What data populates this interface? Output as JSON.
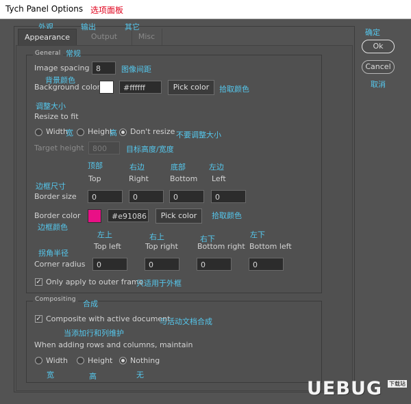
{
  "window": {
    "title": "Tych Panel Options",
    "title_cn": "选项面板"
  },
  "tabs": [
    {
      "label": "Appearance",
      "cn": "外观",
      "active": true
    },
    {
      "label": "Output",
      "cn": "输出",
      "active": false
    },
    {
      "label": "Misc",
      "cn": "其它",
      "active": false
    }
  ],
  "actions": {
    "ok": "Ok",
    "ok_cn": "确定",
    "cancel": "Cancel",
    "cancel_cn": "取消"
  },
  "general": {
    "legend": "General",
    "legend_cn": "常规",
    "image_spacing": {
      "label": "Image spacing",
      "value": "8",
      "cn": "图像间距"
    },
    "background_color": {
      "label": "Background color",
      "cn": "背景颜色",
      "swatch": "#ffffff",
      "value": "#ffffff",
      "button": "Pick color",
      "button_cn": "拾取颜色"
    },
    "resize": {
      "cn": "调整大小",
      "label": "Resize to fit",
      "options": [
        {
          "label": "Width",
          "cn": "宽",
          "selected": false
        },
        {
          "label": "Height",
          "cn": "高",
          "selected": false
        },
        {
          "label": "Don't resize",
          "cn": "不要调整大小",
          "selected": true
        }
      ],
      "target_height": {
        "label": "Target height",
        "value": "800",
        "cn": "目标高度/宽度"
      }
    },
    "sides": [
      {
        "label": "Top",
        "cn": "顶部"
      },
      {
        "label": "Right",
        "cn": "右边"
      },
      {
        "label": "Bottom",
        "cn": "底部"
      },
      {
        "label": "Left",
        "cn": "左边"
      }
    ],
    "border_size": {
      "label": "Border size",
      "cn": "边框尺寸",
      "values": [
        "0",
        "0",
        "0",
        "0"
      ]
    },
    "border_color": {
      "label": "Border color",
      "cn": "边框颜色",
      "swatch": "#e91086",
      "value": "#e91086",
      "button": "Pick color",
      "button_cn": "拾取颜色"
    },
    "corners": [
      {
        "label": "Top left",
        "cn": "左上"
      },
      {
        "label": "Top right",
        "cn": "右上"
      },
      {
        "label": "Bottom right",
        "cn": "右下"
      },
      {
        "label": "Bottom left",
        "cn": "左下"
      }
    ],
    "corner_radius": {
      "label": "Corner radius",
      "cn": "拐角半径",
      "values": [
        "0",
        "0",
        "0",
        "0"
      ]
    },
    "outer_frame": {
      "label": "Only apply to outer frame",
      "cn": "只适用于外框",
      "checked": true
    }
  },
  "compositing": {
    "legend": "Compositing",
    "legend_cn": "合成",
    "composite": {
      "label": "Composite with active document",
      "cn": "与活动文档合成",
      "checked": true
    },
    "maintain_cn": "当添加行和列维护",
    "maintain_label": "When adding rows and columns, maintain",
    "options": [
      {
        "label": "Width",
        "cn": "宽",
        "selected": false
      },
      {
        "label": "Height",
        "cn": "高",
        "selected": false
      },
      {
        "label": "Nothing",
        "cn": "无",
        "selected": true
      }
    ]
  },
  "watermark": {
    "text": "UEBUG",
    "sub": "下载站"
  }
}
